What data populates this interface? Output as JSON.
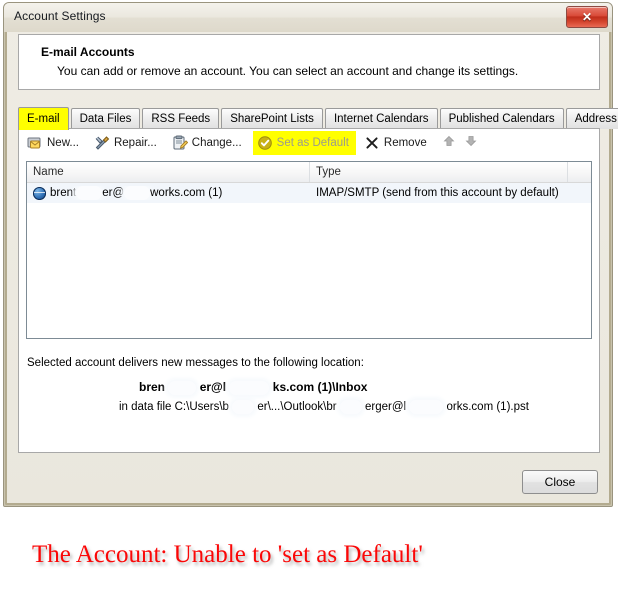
{
  "window": {
    "title": "Account Settings",
    "close_button": "close-button",
    "close_glyph": "✕"
  },
  "header": {
    "title": "E-mail Accounts",
    "subtitle": "You can add or remove an account. You can select an account and change its settings."
  },
  "tabs": [
    {
      "label": "E-mail",
      "active": true
    },
    {
      "label": "Data Files",
      "active": false
    },
    {
      "label": "RSS Feeds",
      "active": false
    },
    {
      "label": "SharePoint Lists",
      "active": false
    },
    {
      "label": "Internet Calendars",
      "active": false
    },
    {
      "label": "Published Calendars",
      "active": false
    },
    {
      "label": "Address Books",
      "active": false
    }
  ],
  "toolbar": {
    "items": [
      {
        "label": "New...",
        "icon": "new-mail-icon",
        "disabled": false,
        "highlighted": false
      },
      {
        "label": "Repair...",
        "icon": "repair-tools-icon",
        "disabled": false,
        "highlighted": false
      },
      {
        "label": "Change...",
        "icon": "change-clipboard-icon",
        "disabled": false,
        "highlighted": false
      },
      {
        "label": "Set as Default",
        "icon": "check-circle-icon",
        "disabled": true,
        "highlighted": true
      },
      {
        "label": "Remove",
        "icon": "remove-x-icon",
        "disabled": false,
        "highlighted": false
      }
    ],
    "move_up": "move-up-arrow",
    "move_down": "move-down-arrow"
  },
  "list": {
    "columns": [
      "Name",
      "Type",
      ""
    ],
    "rows": [
      {
        "name_part1": "brent",
        "name_part2": "er@",
        "name_part3": "works.com (1)",
        "type": "IMAP/SMTP (send from this account by default)",
        "selected": true,
        "icon": "account-globe-icon"
      }
    ]
  },
  "delivery": {
    "label": "Selected account delivers new messages to the following location:",
    "location_part1": "bren",
    "location_part2": "er@l",
    "location_part3": "ks.com (1)\\Inbox",
    "datafile_part1": "in data file C:\\Users\\b",
    "datafile_part2": "er\\...\\Outlook\\br",
    "datafile_part3": "erger@l",
    "datafile_part4": "orks.com (1).pst"
  },
  "footer": {
    "close_label": "Close"
  },
  "caption": {
    "text": "The Account: Unable to 'set as Default'",
    "color": "#fb0707"
  },
  "colors": {
    "highlight": "#ffff00",
    "dialog_bg": "#eae7dd",
    "close_red": "#bf2d1b",
    "selection": "#f2f6fb"
  }
}
